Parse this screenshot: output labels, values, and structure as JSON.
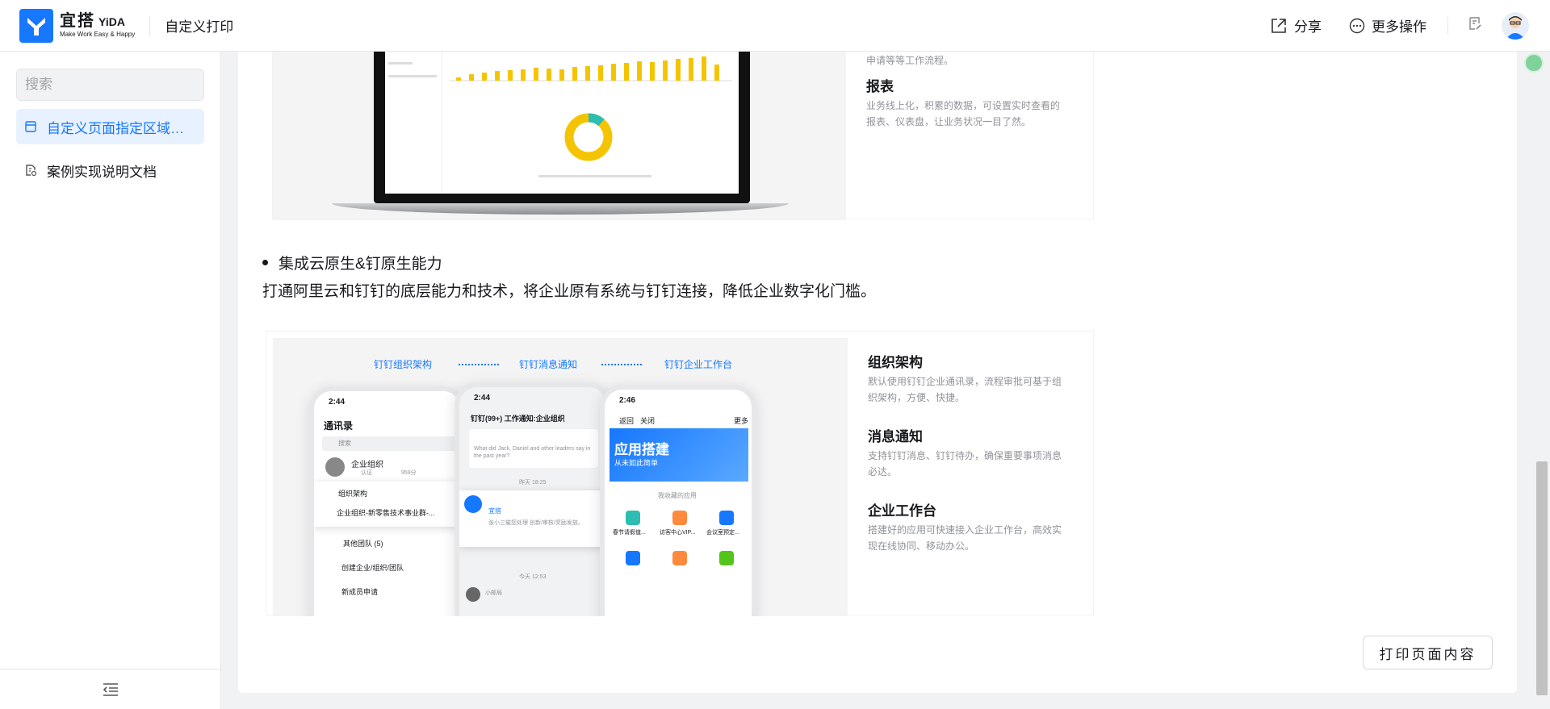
{
  "header": {
    "logo_title": "宜搭",
    "logo_sub": "YiDA",
    "logo_slogan": "Make Work Easy & Happy",
    "app_title": "自定义打印",
    "share_label": "分享",
    "more_label": "更多操作"
  },
  "sidebar": {
    "search_placeholder": "搜索",
    "items": [
      {
        "label": "自定义页面指定区域打印",
        "active": true
      },
      {
        "label": "案例实现说明文档",
        "active": false
      }
    ]
  },
  "content": {
    "top_feature_cut": "申请等等工作流程。",
    "report_title": "报表",
    "report_desc": "业务线上化，积累的数据，可设置实时查看的报表、仪表盘，让业务状况一目了然。",
    "bullet": "集成云原生&钉原生能力",
    "paragraph": "打通阿里云和钉钉的底层能力和技术，将企业原有系统与钉钉连接，降低企业数字化门槛。",
    "tabs": [
      "钉钉组织架构",
      "钉钉消息通知",
      "钉钉企业工作台"
    ],
    "features": [
      {
        "title": "组织架构",
        "desc": "默认使用钉钉企业通讯录，流程审批可基于组织架构，方便、快捷。"
      },
      {
        "title": "消息通知",
        "desc": "支持钉钉消息、钉钉待办，确保重要事项消息必达。"
      },
      {
        "title": "企业工作台",
        "desc": "搭建好的应用可快速接入企业工作台，高效实现在线协同、移动办公。"
      }
    ],
    "phone1": {
      "time": "2:44",
      "title": "通讯录",
      "search": "搜索",
      "org": "企业组织",
      "org_badge": "认证",
      "org_count": "959分",
      "org_struct": "组织架构",
      "org_sub": "企业组织-新零售技术事业群-...",
      "other_teams": "其他团队 (5)",
      "create": "创建企业/组织/团队",
      "new_member": "新成员申请"
    },
    "phone2": {
      "time": "2:44",
      "header": "钉钉(99+) 工作通知:企业组织",
      "msg1": "What did Jack, Daniel and other leaders say in the past year?",
      "time1": "昨天 18:25",
      "app_name": "宜搭",
      "msg2": "张小三催您处理 创新/审核/奖励发放。",
      "time2": "今天 12:53",
      "sender": "小邮局"
    },
    "phone3": {
      "time": "2:46",
      "back": "返回",
      "close": "关闭",
      "more": "更多",
      "banner_title": "应用搭建",
      "banner_sub": "从未如此简单",
      "fav": "我收藏的应用",
      "apps": [
        "春节请假值...",
        "访客中心VIP...",
        "会议室预定..."
      ]
    },
    "print_button": "打印页面内容"
  },
  "colors": {
    "accent": "#1677ff",
    "chart_bar": "#f5c400",
    "active_bg": "#e8f1ff"
  }
}
